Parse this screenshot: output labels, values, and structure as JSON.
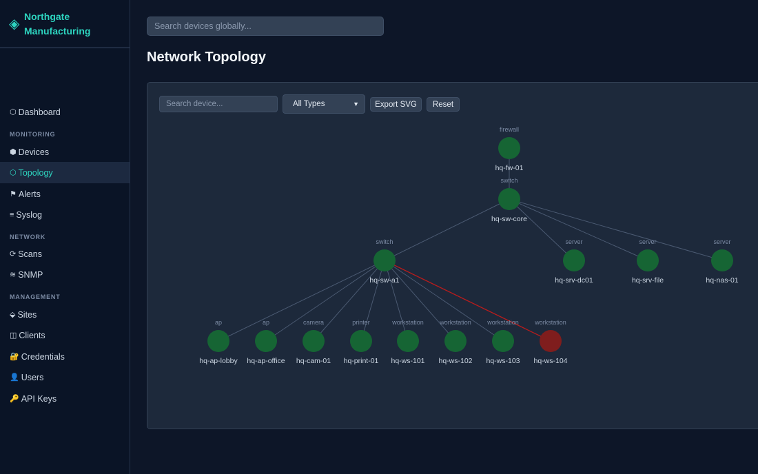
{
  "brand": {
    "icon": "◈",
    "name": "Northgate Manufacturing"
  },
  "nav": {
    "dashboard": {
      "icon": "⬡",
      "label": "Dashboard"
    },
    "monitoring_header": "MONITORING",
    "devices": {
      "icon": "⬢",
      "label": "Devices"
    },
    "topology": {
      "icon": "⬡",
      "label": "Topology"
    },
    "alerts": {
      "icon": "⚑",
      "label": "Alerts"
    },
    "syslog": {
      "icon": "≡",
      "label": "Syslog"
    },
    "network_header": "NETWORK",
    "scans": {
      "icon": "⟳",
      "label": "Scans"
    },
    "snmp": {
      "icon": "≋",
      "label": "SNMP"
    },
    "management_header": "MANAGEMENT",
    "sites": {
      "icon": "⬙",
      "label": "Sites"
    },
    "clients": {
      "icon": "◫",
      "label": "Clients"
    },
    "credentials": {
      "icon": "🔐",
      "label": "Credentials"
    },
    "users": {
      "icon": "👤",
      "label": "Users"
    },
    "api_keys": {
      "icon": "🔑",
      "label": "API Keys"
    }
  },
  "global_search": {
    "placeholder": "Search devices globally..."
  },
  "page_title": "Network Topology",
  "toolbar": {
    "device_search_placeholder": "Search device...",
    "type_filter_selected": "All Types",
    "export_label": "Export SVG",
    "reset_label": "Reset"
  },
  "colors": {
    "accent": "#2dd4bf",
    "node_up": "#166534",
    "node_down": "#7f1d1d",
    "link": "#4b5a72",
    "link_down": "#b91c1c"
  },
  "topology": {
    "nodes": [
      {
        "id": "hq-fw-01",
        "type": "firewall",
        "status": "up"
      },
      {
        "id": "hq-sw-core",
        "type": "switch",
        "status": "up"
      },
      {
        "id": "hq-sw-a1",
        "type": "switch",
        "status": "up"
      },
      {
        "id": "hq-srv-dc01",
        "type": "server",
        "status": "up"
      },
      {
        "id": "hq-srv-file",
        "type": "server",
        "status": "up"
      },
      {
        "id": "hq-nas-01",
        "type": "server",
        "status": "up"
      },
      {
        "id": "hq-ap-lobby",
        "type": "ap",
        "status": "up"
      },
      {
        "id": "hq-ap-office",
        "type": "ap",
        "status": "up"
      },
      {
        "id": "hq-cam-01",
        "type": "camera",
        "status": "up"
      },
      {
        "id": "hq-print-01",
        "type": "printer",
        "status": "up"
      },
      {
        "id": "hq-ws-101",
        "type": "workstation",
        "status": "up"
      },
      {
        "id": "hq-ws-102",
        "type": "workstation",
        "status": "up"
      },
      {
        "id": "hq-ws-103",
        "type": "workstation",
        "status": "up"
      },
      {
        "id": "hq-ws-104",
        "type": "workstation",
        "status": "down"
      }
    ],
    "links": [
      {
        "from": "hq-fw-01",
        "to": "hq-sw-core",
        "status": "up"
      },
      {
        "from": "hq-sw-core",
        "to": "hq-sw-a1",
        "status": "up"
      },
      {
        "from": "hq-sw-core",
        "to": "hq-srv-dc01",
        "status": "up"
      },
      {
        "from": "hq-sw-core",
        "to": "hq-srv-file",
        "status": "up"
      },
      {
        "from": "hq-sw-core",
        "to": "hq-nas-01",
        "status": "up"
      },
      {
        "from": "hq-sw-a1",
        "to": "hq-ap-lobby",
        "status": "up"
      },
      {
        "from": "hq-sw-a1",
        "to": "hq-ap-office",
        "status": "up"
      },
      {
        "from": "hq-sw-a1",
        "to": "hq-cam-01",
        "status": "up"
      },
      {
        "from": "hq-sw-a1",
        "to": "hq-print-01",
        "status": "up"
      },
      {
        "from": "hq-sw-a1",
        "to": "hq-ws-101",
        "status": "up"
      },
      {
        "from": "hq-sw-a1",
        "to": "hq-ws-102",
        "status": "up"
      },
      {
        "from": "hq-sw-a1",
        "to": "hq-ws-103",
        "status": "up"
      },
      {
        "from": "hq-sw-a1",
        "to": "hq-ws-104",
        "status": "down"
      }
    ]
  }
}
